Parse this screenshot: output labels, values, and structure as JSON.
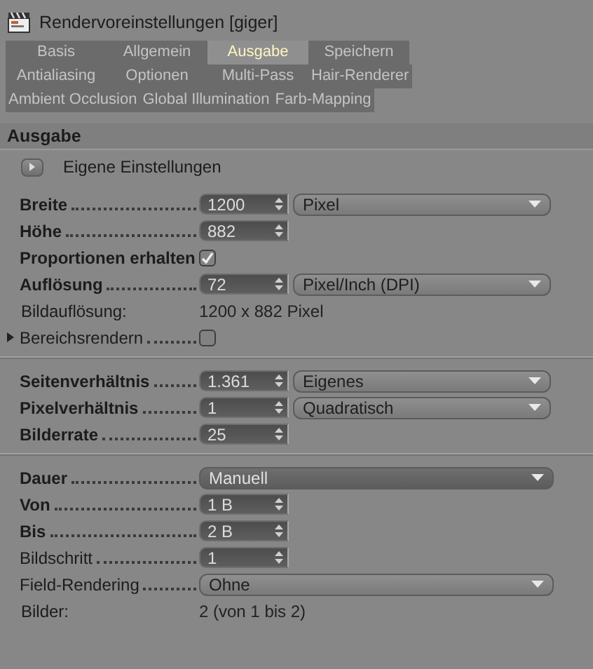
{
  "window": {
    "title": "Rendervoreinstellungen [giger]"
  },
  "tabs": [
    {
      "label": "Basis",
      "selected": false
    },
    {
      "label": "Allgemein",
      "selected": false
    },
    {
      "label": "Ausgabe",
      "selected": true
    },
    {
      "label": "Speichern",
      "selected": false
    },
    {
      "label": "Antialiasing",
      "selected": false
    },
    {
      "label": "Optionen",
      "selected": false
    },
    {
      "label": "Multi-Pass",
      "selected": false
    },
    {
      "label": "Hair-Renderer",
      "selected": false
    },
    {
      "label": "Ambient Occlusion",
      "selected": false
    },
    {
      "label": "Global Illumination",
      "selected": false
    },
    {
      "label": "Farb-Mapping",
      "selected": false
    }
  ],
  "section": {
    "title": "Ausgabe",
    "preset_label": "Eigene Einstellungen"
  },
  "groups": [
    [
      {
        "kind": "number",
        "label": "Breite",
        "bold": true,
        "value": "1200",
        "unit": "Pixel"
      },
      {
        "kind": "number",
        "label": "Höhe",
        "bold": true,
        "value": "882"
      },
      {
        "kind": "inline_checkbox",
        "label": "Proportionen erhalten",
        "bold": true,
        "checked": true
      },
      {
        "kind": "number",
        "label": "Auflösung",
        "bold": true,
        "value": "72",
        "unit": "Pixel/Inch (DPI)"
      },
      {
        "kind": "info",
        "label": "Bildauflösung:",
        "bold": false,
        "value": "1200 x 882 Pixel"
      },
      {
        "kind": "checkbox",
        "label": "Bereichsrendern",
        "bold": false,
        "checked": false,
        "expanded": false
      }
    ],
    [
      {
        "kind": "number",
        "label": "Seitenverhältnis",
        "bold": true,
        "value": "1.361",
        "unit": "Eigenes"
      },
      {
        "kind": "number",
        "label": "Pixelverhältnis",
        "bold": true,
        "value": "1",
        "unit": "Quadratisch"
      },
      {
        "kind": "number",
        "label": "Bilderrate",
        "bold": true,
        "value": "25"
      }
    ],
    [
      {
        "kind": "dropdown",
        "label": "Dauer",
        "bold": true,
        "value": "Manuell",
        "dark": true
      },
      {
        "kind": "number",
        "label": "Von",
        "bold": true,
        "value": "1 B"
      },
      {
        "kind": "number",
        "label": "Bis",
        "bold": true,
        "value": "2 B"
      },
      {
        "kind": "number",
        "label": "Bildschritt",
        "bold": false,
        "value": "1"
      },
      {
        "kind": "dropdown",
        "label": "Field-Rendering",
        "bold": false,
        "value": "Ohne",
        "dark": false
      },
      {
        "kind": "info",
        "label": "Bilder:",
        "bold": false,
        "value": "2 (von 1 bis 2)"
      }
    ]
  ]
}
